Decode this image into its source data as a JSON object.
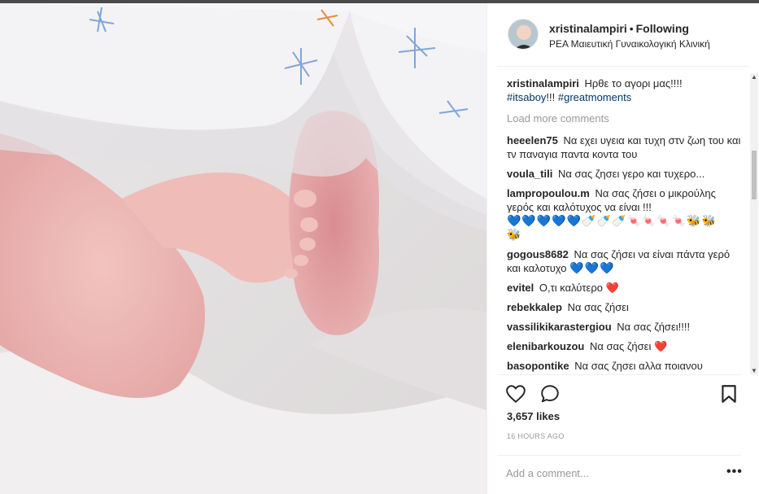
{
  "post": {
    "username": "xristinalampiri",
    "separator": "•",
    "follow_label": "Following",
    "location": "ΡΕΑ Μαιευτική Γυναικολογική Κλινική"
  },
  "caption": {
    "user": "xristinalampiri",
    "text": "Ηρθε το αγορι μας!!!!",
    "tag1": "#itsaboy",
    "mid": "!!!",
    "tag2": "#greatmoments"
  },
  "load_more": "Load more comments",
  "comments": [
    {
      "user": "heeelen75",
      "text": "Να εχει υγεια και τυχη στν ζωη του και τν παναγια παντα κοντα του"
    },
    {
      "user": "voula_tili",
      "text": "Να σας ζησει γερο και τυχερο..."
    },
    {
      "user": "lampropoulou.m",
      "text": "Να σας ζήσει ο μικρούλης γερός και καλότυχος να είναι !!!"
    },
    {
      "user": "gogous8682",
      "text": "Να σας ζήσει να είναι πάντα γερό και καλοτυχο"
    },
    {
      "user": "evitel",
      "text": "Ο,τι καλύτερο"
    },
    {
      "user": "rebekkalep",
      "text": "Να σας ζήσει"
    },
    {
      "user": "vassilikikarastergiou",
      "text": "Να σας ζήσει!!!!"
    },
    {
      "user": "elenibarkouzou",
      "text": "Να σας ζήσει"
    },
    {
      "user": "basopontike",
      "text": "Να σας ζησει αλλα ποιανου"
    }
  ],
  "emojis": {
    "blue_hearts_5": "💙💙💙💙💙",
    "bottles": "🍼🍼🍼",
    "candies": "🍬🍬🍬🍬",
    "bees_2": "🐝🐝",
    "bee_1": "🐝",
    "blue_hearts_3": "💙💙💙",
    "red_heart": "❤️"
  },
  "likes": "3,657 likes",
  "timestamp": "16 HOURS AGO",
  "add_comment_placeholder": "Add a comment...",
  "more_options": "•••",
  "scroll_up": "▲",
  "scroll_down": "▼",
  "icons": {
    "like": "heart-icon",
    "comment": "comment-bubble-icon",
    "save": "bookmark-icon",
    "more": "more-dots-icon"
  }
}
